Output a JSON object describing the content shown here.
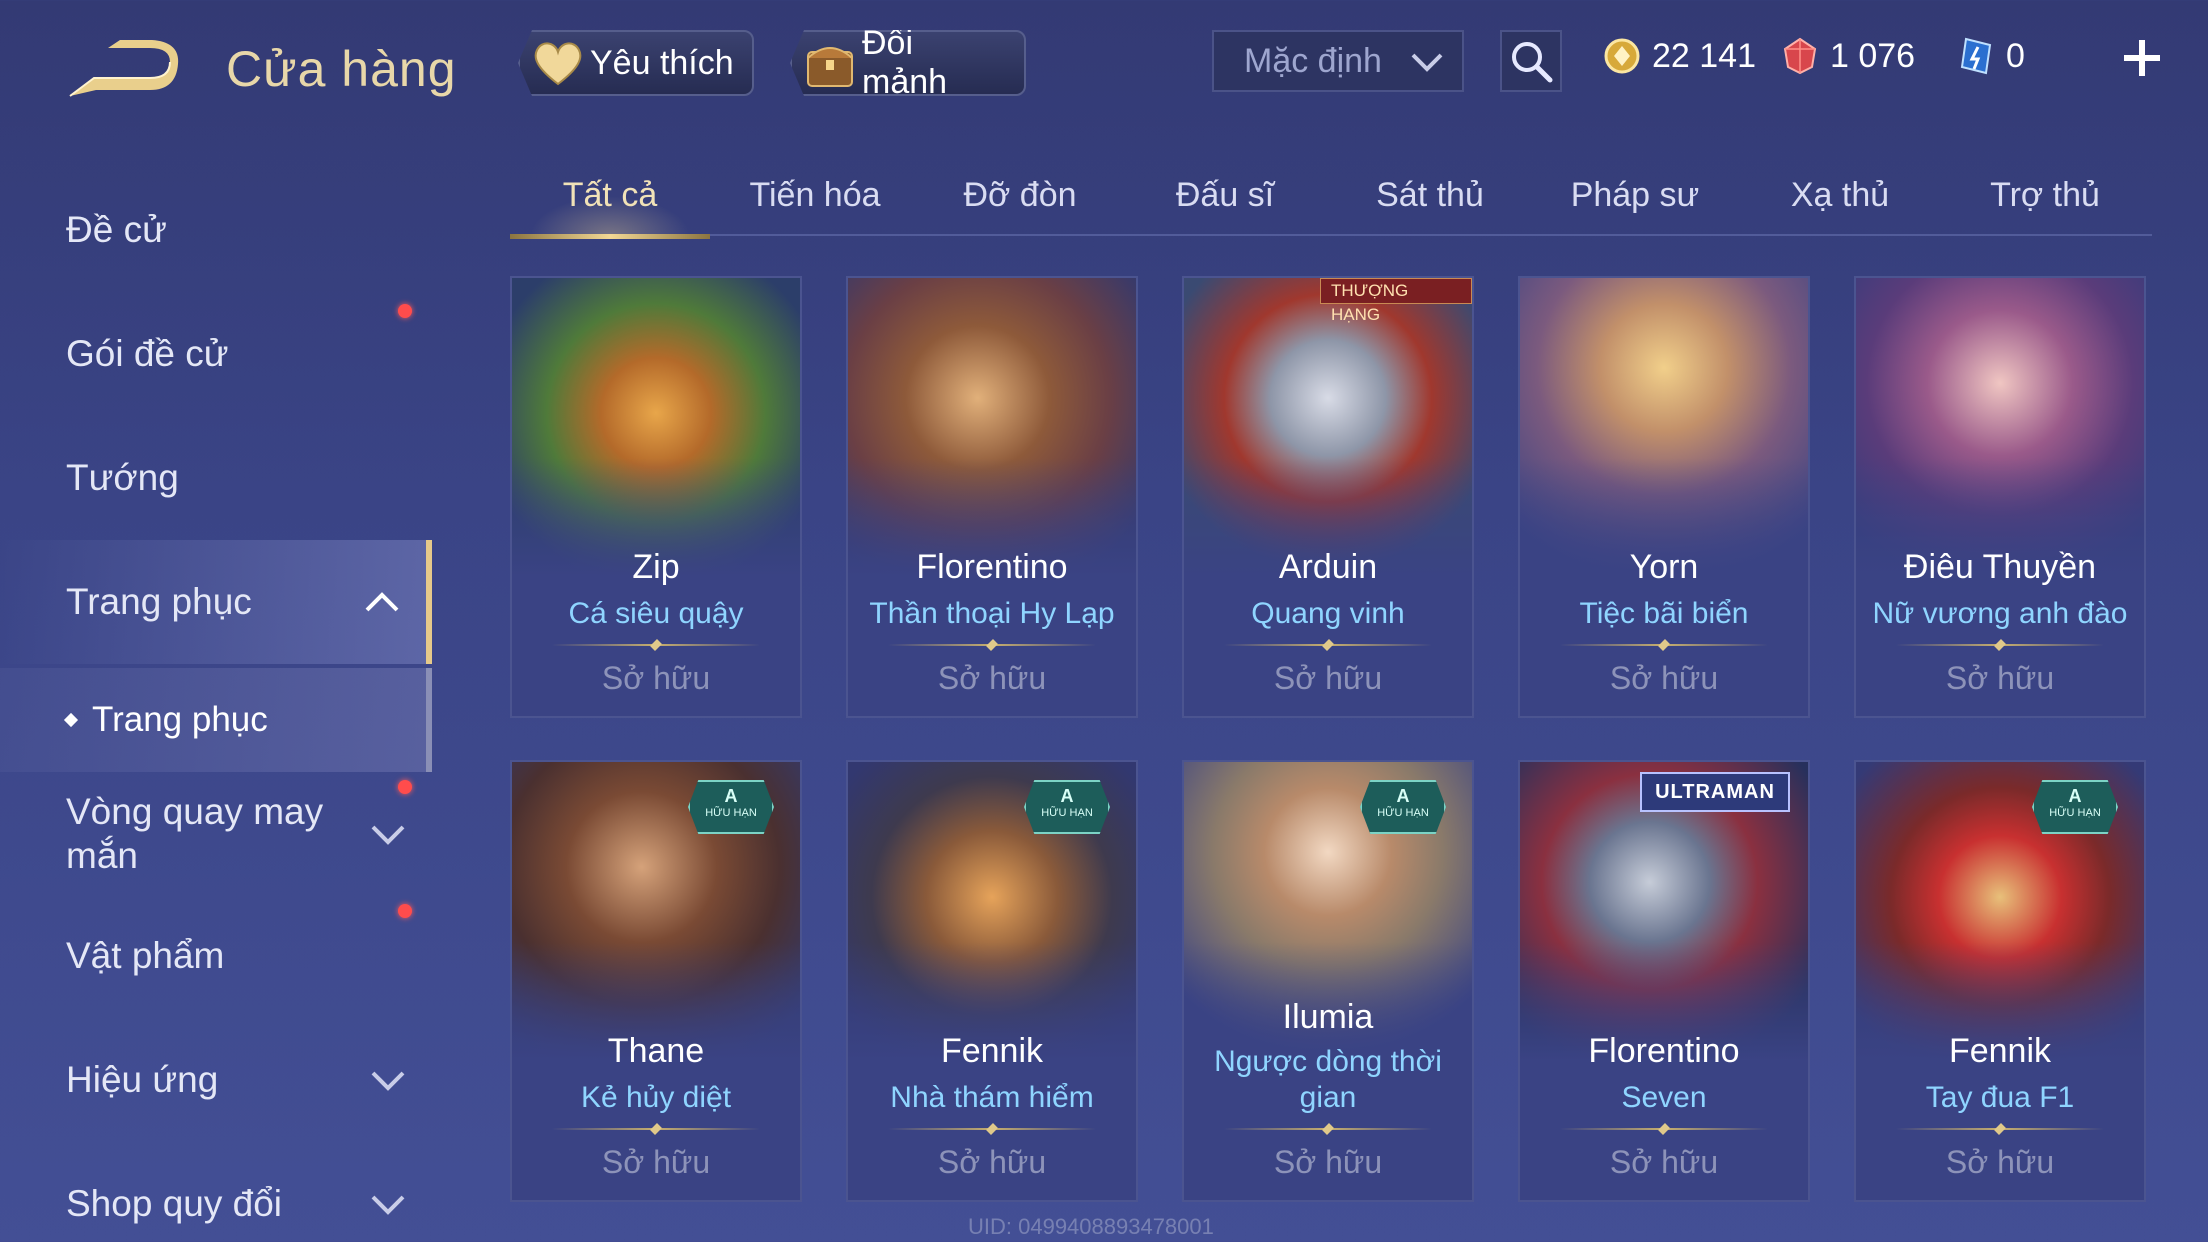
{
  "header": {
    "title": "Cửa hàng",
    "favorites_label": "Yêu thích",
    "exchange_label": "Đổi mảnh",
    "sort_value": "Mặc định",
    "currencies": [
      {
        "icon": "gold-coin-icon",
        "value": "22 141"
      },
      {
        "icon": "ruby-gem-icon",
        "value": "1 076"
      },
      {
        "icon": "voucher-icon",
        "value": "0"
      }
    ]
  },
  "sidebar": {
    "items": [
      {
        "label": "Đề cử"
      },
      {
        "label": "Gói đề cử"
      },
      {
        "label": "Tướng"
      },
      {
        "label": "Trang phục"
      },
      {
        "label": "Vòng quay may mắn"
      },
      {
        "label": "Vật phẩm"
      },
      {
        "label": "Hiệu ứng"
      },
      {
        "label": "Shop quy đổi"
      }
    ],
    "sub_item": "Trang phục"
  },
  "tabs": [
    "Tất cả",
    "Tiến hóa",
    "Đỡ đòn",
    "Đấu sĩ",
    "Sát thủ",
    "Pháp sư",
    "Xạ thủ",
    "Trợ thủ"
  ],
  "cards": [
    {
      "hero": "Zip",
      "skin": "Cá siêu quậy",
      "status": "Sở hữu"
    },
    {
      "hero": "Florentino",
      "skin": "Thần thoại Hy Lạp",
      "status": "Sở hữu"
    },
    {
      "hero": "Arduin",
      "skin": "Quang vinh",
      "status": "Sở hữu",
      "tag": "THƯỢNG HẠNG"
    },
    {
      "hero": "Yorn",
      "skin": "Tiệc bãi biển",
      "status": "Sở hữu"
    },
    {
      "hero": "Điêu Thuyền",
      "skin": "Nữ vương anh đào",
      "status": "Sở hữu"
    },
    {
      "hero": "Thane",
      "skin": "Kẻ hủy diệt",
      "status": "Sở hữu",
      "grade": "A",
      "grade_note": "HỮU HẠN"
    },
    {
      "hero": "Fennik",
      "skin": "Nhà thám hiểm",
      "status": "Sở hữu",
      "grade": "A",
      "grade_note": "HỮU HẠN"
    },
    {
      "hero": "Ilumia",
      "skin": "Ngược dòng thời gian",
      "status": "Sở hữu",
      "grade": "A",
      "grade_note": "HỮU HẠN"
    },
    {
      "hero": "Florentino",
      "skin": "Seven",
      "status": "Sở hữu",
      "tag": "ULTRAMAN"
    },
    {
      "hero": "Fennik",
      "skin": "Tay đua F1",
      "status": "Sở hữu",
      "grade": "A",
      "grade_note": "HỮU HẠN"
    }
  ],
  "uid_text": "UID: 0499408893478001"
}
